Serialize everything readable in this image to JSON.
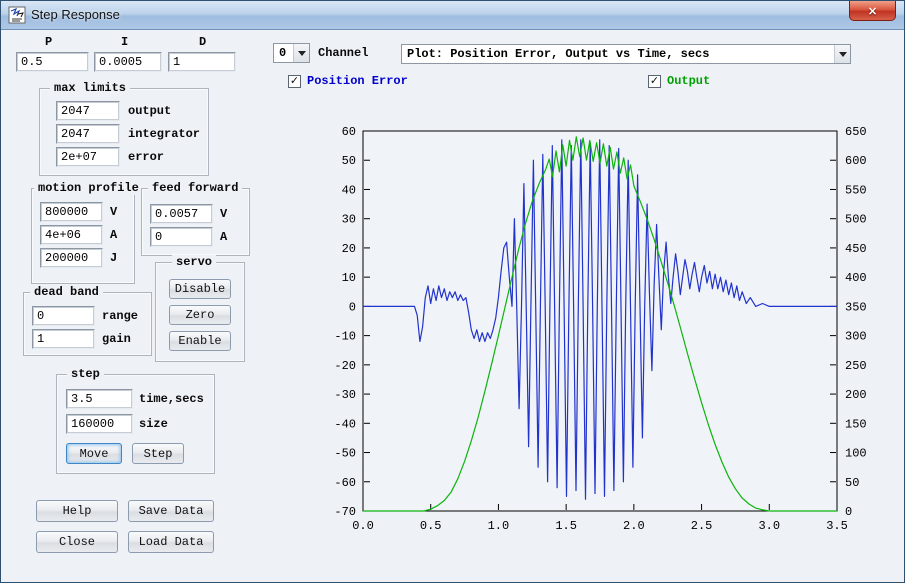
{
  "window": {
    "title": "Step Response"
  },
  "pid": {
    "p_label": "P",
    "i_label": "I",
    "d_label": "D",
    "p": "0.5",
    "i": "0.0005",
    "d": "1"
  },
  "channel": {
    "value": "0",
    "label": "Channel"
  },
  "plot_combo": {
    "value": "Plot: Position Error, Output vs Time, secs"
  },
  "checkboxes": {
    "position_error": {
      "label": "Position Error",
      "checked": true,
      "color": "#0000cc"
    },
    "output": {
      "label": "Output",
      "checked": true,
      "color": "#00a000"
    }
  },
  "max_limits": {
    "title": "max limits",
    "rows": [
      {
        "value": "2047",
        "label": "output"
      },
      {
        "value": "2047",
        "label": "integrator"
      },
      {
        "value": "2e+07",
        "label": "error"
      }
    ]
  },
  "motion_profile": {
    "title": "motion profile",
    "rows": [
      {
        "value": "800000",
        "label": "V"
      },
      {
        "value": "4e+06",
        "label": "A"
      },
      {
        "value": "200000",
        "label": "J"
      }
    ]
  },
  "feed_forward": {
    "title": "feed forward",
    "rows": [
      {
        "value": "0.0057",
        "label": "V"
      },
      {
        "value": "0",
        "label": "A"
      }
    ]
  },
  "servo": {
    "title": "servo",
    "buttons": [
      "Disable",
      "Zero",
      "Enable"
    ]
  },
  "dead_band": {
    "title": "dead band",
    "rows": [
      {
        "value": "0",
        "label": "range"
      },
      {
        "value": "1",
        "label": "gain"
      }
    ]
  },
  "step": {
    "title": "step",
    "rows": [
      {
        "value": "3.5",
        "label": "time,secs"
      },
      {
        "value": "160000",
        "label": "size"
      }
    ],
    "buttons": [
      "Move",
      "Step"
    ]
  },
  "bottom_buttons": {
    "help": "Help",
    "save": "Save Data",
    "close": "Close",
    "load": "Load Data"
  },
  "chart_data": {
    "type": "line",
    "title": "",
    "x_range": [
      0,
      3.5
    ],
    "left_range": [
      -70,
      60
    ],
    "right_range": [
      0,
      650
    ],
    "x_ticks": [
      0.0,
      0.5,
      1.0,
      1.5,
      2.0,
      2.5,
      3.0,
      3.5
    ],
    "left_ticks": [
      60,
      50,
      40,
      30,
      20,
      10,
      0,
      -10,
      -20,
      -30,
      -40,
      -50,
      -60,
      -70
    ],
    "right_ticks": [
      650,
      600,
      550,
      500,
      450,
      400,
      350,
      300,
      250,
      200,
      150,
      100,
      50,
      0
    ],
    "grid": false,
    "plot_bg": "#f0f3f8",
    "series": [
      {
        "name": "Position Error",
        "axis": "left",
        "color": "#2233cc",
        "points": [
          [
            0,
            0
          ],
          [
            0.1,
            0
          ],
          [
            0.2,
            0
          ],
          [
            0.3,
            0
          ],
          [
            0.38,
            0
          ],
          [
            0.4,
            -3
          ],
          [
            0.42,
            -12
          ],
          [
            0.44,
            -7
          ],
          [
            0.46,
            3
          ],
          [
            0.48,
            7
          ],
          [
            0.5,
            1
          ],
          [
            0.52,
            6
          ],
          [
            0.54,
            2
          ],
          [
            0.56,
            7
          ],
          [
            0.58,
            3
          ],
          [
            0.6,
            6
          ],
          [
            0.62,
            2
          ],
          [
            0.64,
            5
          ],
          [
            0.66,
            3
          ],
          [
            0.68,
            5
          ],
          [
            0.7,
            2
          ],
          [
            0.72,
            4
          ],
          [
            0.74,
            2
          ],
          [
            0.76,
            3
          ],
          [
            0.78,
            -2
          ],
          [
            0.8,
            -8
          ],
          [
            0.82,
            -11
          ],
          [
            0.84,
            -8
          ],
          [
            0.86,
            -12
          ],
          [
            0.88,
            -9
          ],
          [
            0.9,
            -12
          ],
          [
            0.92,
            -9
          ],
          [
            0.94,
            -11
          ],
          [
            0.96,
            -8
          ],
          [
            0.98,
            -4
          ],
          [
            1,
            3
          ],
          [
            1.02,
            12
          ],
          [
            1.04,
            20
          ],
          [
            1.06,
            22
          ],
          [
            1.08,
            10
          ],
          [
            1.1,
            0
          ],
          [
            1.118,
            30
          ],
          [
            1.135,
            0
          ],
          [
            1.153,
            -35
          ],
          [
            1.17,
            0
          ],
          [
            1.188,
            42
          ],
          [
            1.205,
            0
          ],
          [
            1.223,
            -48
          ],
          [
            1.24,
            0
          ],
          [
            1.258,
            50
          ],
          [
            1.275,
            0
          ],
          [
            1.293,
            -55
          ],
          [
            1.31,
            0
          ],
          [
            1.328,
            52
          ],
          [
            1.345,
            0
          ],
          [
            1.363,
            -60
          ],
          [
            1.38,
            0
          ],
          [
            1.398,
            55
          ],
          [
            1.415,
            0
          ],
          [
            1.433,
            -62
          ],
          [
            1.45,
            0
          ],
          [
            1.468,
            57
          ],
          [
            1.485,
            0
          ],
          [
            1.503,
            -65
          ],
          [
            1.52,
            0
          ],
          [
            1.538,
            55
          ],
          [
            1.555,
            0
          ],
          [
            1.573,
            -63
          ],
          [
            1.59,
            0
          ],
          [
            1.608,
            57
          ],
          [
            1.625,
            0
          ],
          [
            1.643,
            -66
          ],
          [
            1.66,
            0
          ],
          [
            1.678,
            56
          ],
          [
            1.695,
            0
          ],
          [
            1.713,
            -64
          ],
          [
            1.73,
            0
          ],
          [
            1.748,
            57
          ],
          [
            1.765,
            0
          ],
          [
            1.783,
            -65
          ],
          [
            1.8,
            0
          ],
          [
            1.818,
            55
          ],
          [
            1.835,
            0
          ],
          [
            1.853,
            -63
          ],
          [
            1.87,
            0
          ],
          [
            1.888,
            54
          ],
          [
            1.905,
            0
          ],
          [
            1.923,
            -60
          ],
          [
            1.94,
            0
          ],
          [
            1.958,
            50
          ],
          [
            1.975,
            0
          ],
          [
            1.993,
            -55
          ],
          [
            2.01,
            0
          ],
          [
            2.028,
            45
          ],
          [
            2.045,
            0
          ],
          [
            2.063,
            -45
          ],
          [
            2.08,
            0
          ],
          [
            2.098,
            35
          ],
          [
            2.115,
            5
          ],
          [
            2.133,
            -22
          ],
          [
            2.15,
            8
          ],
          [
            2.168,
            28
          ],
          [
            2.185,
            10
          ],
          [
            2.203,
            -8
          ],
          [
            2.22,
            12
          ],
          [
            2.238,
            22
          ],
          [
            2.255,
            10
          ],
          [
            2.273,
            1
          ],
          [
            2.29,
            10
          ],
          [
            2.308,
            18
          ],
          [
            2.325,
            12
          ],
          [
            2.343,
            4
          ],
          [
            2.36,
            10
          ],
          [
            2.378,
            16
          ],
          [
            2.395,
            12
          ],
          [
            2.413,
            6
          ],
          [
            2.43,
            11
          ],
          [
            2.448,
            15
          ],
          [
            2.465,
            10
          ],
          [
            2.483,
            5
          ],
          [
            2.5,
            10
          ],
          [
            2.52,
            14
          ],
          [
            2.54,
            8
          ],
          [
            2.56,
            12
          ],
          [
            2.58,
            6
          ],
          [
            2.6,
            11
          ],
          [
            2.62,
            6
          ],
          [
            2.64,
            10
          ],
          [
            2.66,
            5
          ],
          [
            2.68,
            9
          ],
          [
            2.7,
            4
          ],
          [
            2.72,
            8
          ],
          [
            2.74,
            3
          ],
          [
            2.76,
            7
          ],
          [
            2.78,
            2
          ],
          [
            2.8,
            5
          ],
          [
            2.83,
            1
          ],
          [
            2.86,
            3
          ],
          [
            2.9,
            0
          ],
          [
            2.95,
            1
          ],
          [
            3,
            0
          ],
          [
            3.1,
            0
          ],
          [
            3.2,
            0
          ],
          [
            3.3,
            0
          ],
          [
            3.4,
            0
          ],
          [
            3.5,
            0
          ]
        ]
      },
      {
        "name": "Output",
        "axis": "right",
        "color": "#0cb40c",
        "points": [
          [
            0,
            0
          ],
          [
            0.2,
            0
          ],
          [
            0.4,
            0
          ],
          [
            0.45,
            0
          ],
          [
            0.5,
            3
          ],
          [
            0.55,
            9
          ],
          [
            0.6,
            18
          ],
          [
            0.65,
            32
          ],
          [
            0.7,
            55
          ],
          [
            0.75,
            85
          ],
          [
            0.8,
            120
          ],
          [
            0.85,
            160
          ],
          [
            0.9,
            205
          ],
          [
            0.95,
            252
          ],
          [
            1,
            300
          ],
          [
            1.05,
            350
          ],
          [
            1.1,
            400
          ],
          [
            1.15,
            448
          ],
          [
            1.2,
            492
          ],
          [
            1.25,
            530
          ],
          [
            1.3,
            560
          ],
          [
            1.35,
            585
          ],
          [
            1.375,
            602
          ],
          [
            1.4,
            572
          ],
          [
            1.425,
            616
          ],
          [
            1.45,
            580
          ],
          [
            1.475,
            626
          ],
          [
            1.5,
            590
          ],
          [
            1.525,
            634
          ],
          [
            1.55,
            600
          ],
          [
            1.575,
            640
          ],
          [
            1.6,
            606
          ],
          [
            1.625,
            638
          ],
          [
            1.65,
            600
          ],
          [
            1.675,
            634
          ],
          [
            1.7,
            598
          ],
          [
            1.725,
            630
          ],
          [
            1.75,
            595
          ],
          [
            1.775,
            628
          ],
          [
            1.8,
            590
          ],
          [
            1.825,
            622
          ],
          [
            1.85,
            585
          ],
          [
            1.875,
            614
          ],
          [
            1.9,
            578
          ],
          [
            1.925,
            604
          ],
          [
            1.95,
            568
          ],
          [
            1.975,
            592
          ],
          [
            2,
            556
          ],
          [
            2.05,
            528
          ],
          [
            2.1,
            498
          ],
          [
            2.15,
            464
          ],
          [
            2.2,
            428
          ],
          [
            2.25,
            390
          ],
          [
            2.3,
            350
          ],
          [
            2.35,
            308
          ],
          [
            2.4,
            266
          ],
          [
            2.45,
            225
          ],
          [
            2.5,
            185
          ],
          [
            2.55,
            148
          ],
          [
            2.6,
            114
          ],
          [
            2.65,
            84
          ],
          [
            2.7,
            58
          ],
          [
            2.75,
            38
          ],
          [
            2.8,
            22
          ],
          [
            2.85,
            12
          ],
          [
            2.9,
            5
          ],
          [
            2.95,
            2
          ],
          [
            3,
            0
          ],
          [
            3.1,
            0
          ],
          [
            3.25,
            0
          ],
          [
            3.5,
            0
          ]
        ]
      }
    ]
  }
}
